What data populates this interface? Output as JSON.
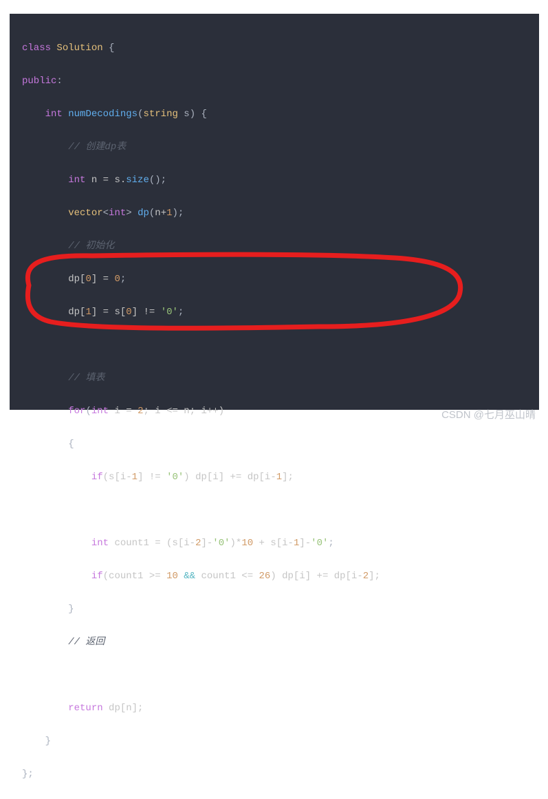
{
  "code": {
    "l1_class": "class",
    "l1_name": "Solution",
    "l1_brace": " {",
    "l2_public": "public",
    "l2_colon": ":",
    "l3_type": "int",
    "l3_fn": "numDecodings",
    "l3_paren_o": "(",
    "l3_ptype": "string",
    "l3_pname": " s",
    "l3_paren_c": ")",
    "l3_brace": " {",
    "l4_comment": "// 创建dp表",
    "l5_type": "int",
    "l5_rest": " n = s.",
    "l5_size": "size",
    "l5_call": "();",
    "l6_vec": "vector",
    "l6_lt": "<",
    "l6_int": "int",
    "l6_gt": ">",
    "l6_dp": " dp",
    "l6_po": "(",
    "l6_np1": "n+",
    "l6_one": "1",
    "l6_pc": ");",
    "l7_comment": "// 初始化",
    "l8a": "dp[",
    "l8_zero": "0",
    "l8b": "] = ",
    "l8_zero2": "0",
    "l8c": ";",
    "l9a": "dp[",
    "l9_one": "1",
    "l9b": "] = s[",
    "l9_zero": "0",
    "l9c": "] != ",
    "l9_str": "'0'",
    "l9d": ";",
    "l11_comment": "// 填表",
    "l12_for": "for",
    "l12a": "(",
    "l12_int": "int",
    "l12b": " i = ",
    "l12_two": "2",
    "l12c": "; i <= n; i++)",
    "l13": "{",
    "l14_if": "if",
    "l14a": "(s[i-",
    "l14_one": "1",
    "l14b": "] != ",
    "l14_str": "'0'",
    "l14c": ") dp[i] += dp[i-",
    "l14_one2": "1",
    "l14d": "];",
    "l16_int": "int",
    "l16a": " count1 = (s[i-",
    "l16_two": "2",
    "l16b": "]-",
    "l16_str1": "'0'",
    "l16c": ")*",
    "l16_ten": "10",
    "l16d": " + s[i-",
    "l16_one": "1",
    "l16e": "]-",
    "l16_str2": "'0'",
    "l16f": ";",
    "l17_if": "if",
    "l17a": "(count1 >= ",
    "l17_ten": "10",
    "l17b": " ",
    "l17_and": "&&",
    "l17c": " count1 <= ",
    "l17_tw6": "26",
    "l17d": ") dp[i] += dp[i-",
    "l17_two": "2",
    "l17e": "];",
    "l18": "}",
    "l19_comment": "// 返回",
    "l21_ret": "return",
    "l21a": " dp[n];",
    "l22": "}",
    "l23": "};"
  },
  "watermark": "CSDN @七月巫山晴"
}
